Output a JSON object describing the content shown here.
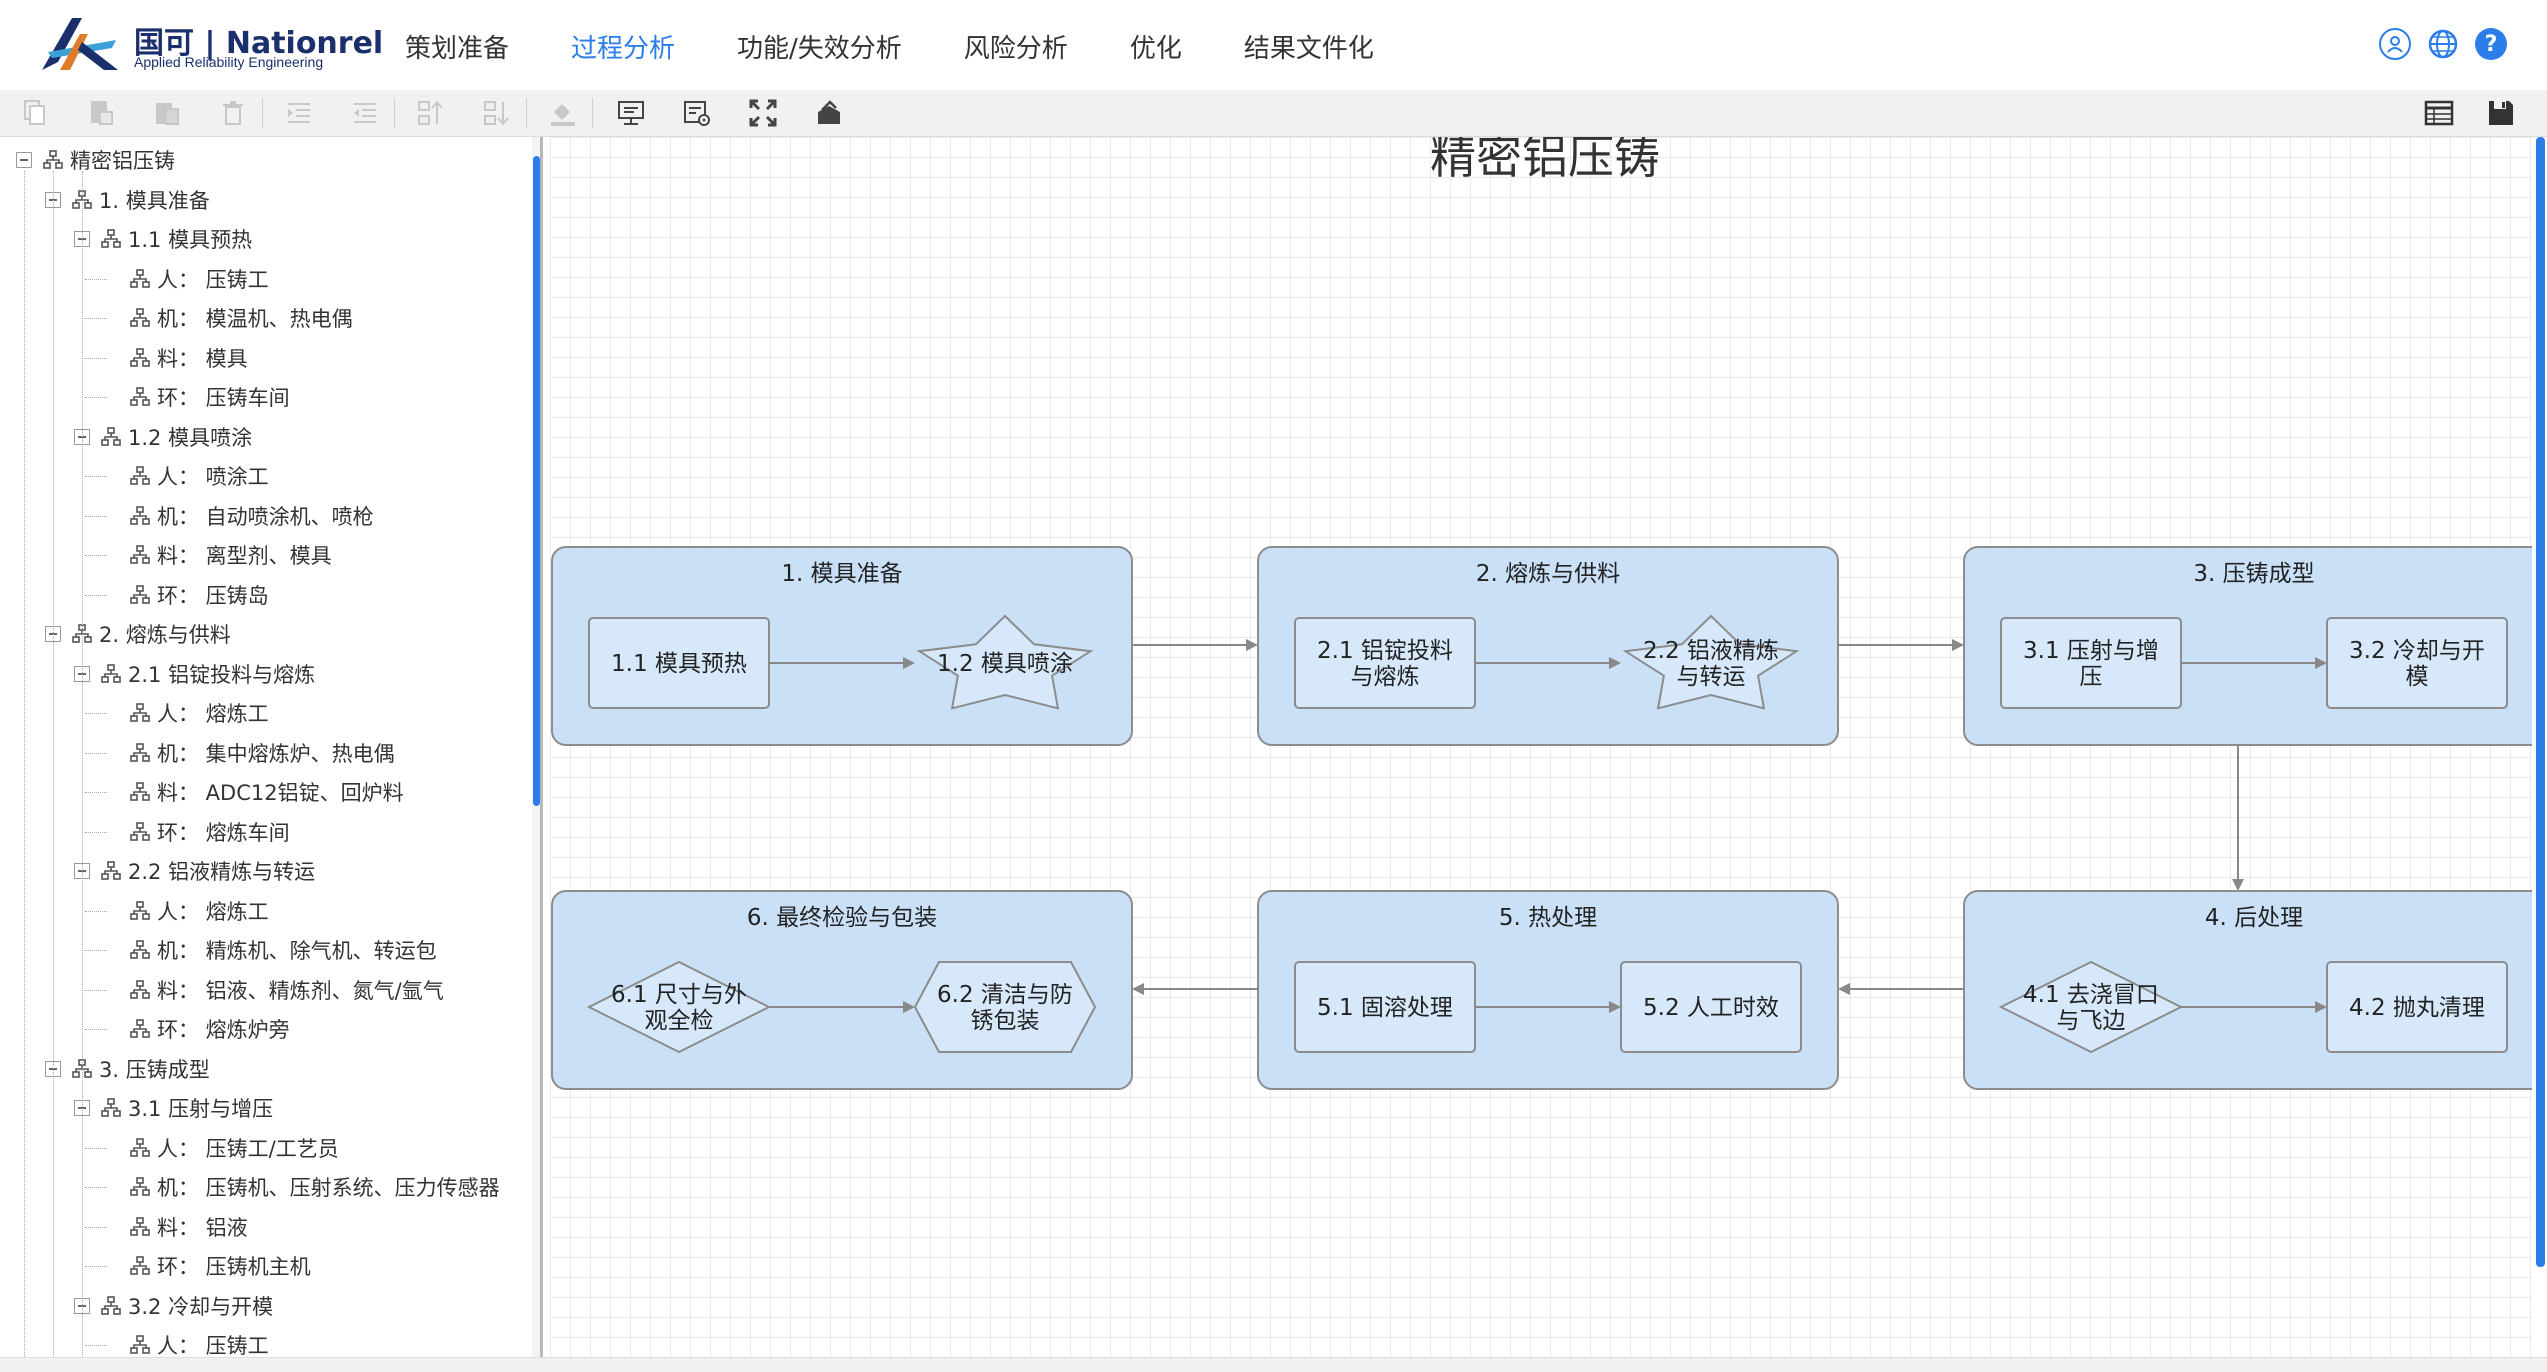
{
  "header": {
    "logo_cn": "国可 | Nationrel",
    "logo_en": "Applied Reliability Engineering",
    "nav": [
      {
        "label": "策划准备",
        "active": false
      },
      {
        "label": "过程分析",
        "active": true
      },
      {
        "label": "功能/失效分析",
        "active": false
      },
      {
        "label": "风险分析",
        "active": false
      },
      {
        "label": "优化",
        "active": false
      },
      {
        "label": "结果文件化",
        "active": false
      }
    ],
    "icons": [
      "user-icon",
      "globe-icon",
      "help-icon"
    ],
    "help_glyph": "?",
    "accent": "#2b7de9"
  },
  "toolbar": {
    "buttons": [
      "copy-icon",
      "paste-icon",
      "clipboard-icon",
      "delete-icon",
      "indent-icon",
      "outdent-icon",
      "move-up-icon",
      "move-down-icon",
      "fill-color-icon",
      "display-icon",
      "settings-icon",
      "fullscreen-icon",
      "layout-icon"
    ],
    "right_buttons": [
      "table-icon",
      "save-icon"
    ]
  },
  "tree": {
    "nodes": [
      {
        "level": 0,
        "label": "精密铝压铸",
        "toggle": true
      },
      {
        "level": 1,
        "label": "1. 模具准备",
        "toggle": true
      },
      {
        "level": 2,
        "label": "1.1 模具预热",
        "toggle": true
      },
      {
        "level": 3,
        "label": "人：  压铸工",
        "toggle": false
      },
      {
        "level": 3,
        "label": "机：  模温机、热电偶",
        "toggle": false
      },
      {
        "level": 3,
        "label": "料：  模具",
        "toggle": false
      },
      {
        "level": 3,
        "label": "环：  压铸车间",
        "toggle": false
      },
      {
        "level": 2,
        "label": "1.2 模具喷涂",
        "toggle": true
      },
      {
        "level": 3,
        "label": "人：  喷涂工",
        "toggle": false
      },
      {
        "level": 3,
        "label": "机：  自动喷涂机、喷枪",
        "toggle": false
      },
      {
        "level": 3,
        "label": "料：  离型剂、模具",
        "toggle": false
      },
      {
        "level": 3,
        "label": "环：  压铸岛",
        "toggle": false
      },
      {
        "level": 1,
        "label": "2. 熔炼与供料",
        "toggle": true
      },
      {
        "level": 2,
        "label": "2.1 铝锭投料与熔炼",
        "toggle": true
      },
      {
        "level": 3,
        "label": "人：  熔炼工",
        "toggle": false
      },
      {
        "level": 3,
        "label": "机：  集中熔炼炉、热电偶",
        "toggle": false
      },
      {
        "level": 3,
        "label": "料：  ADC12铝锭、回炉料",
        "toggle": false
      },
      {
        "level": 3,
        "label": "环：  熔炼车间",
        "toggle": false
      },
      {
        "level": 2,
        "label": "2.2 铝液精炼与转运",
        "toggle": true
      },
      {
        "level": 3,
        "label": "人：  熔炼工",
        "toggle": false
      },
      {
        "level": 3,
        "label": "机：  精炼机、除气机、转运包",
        "toggle": false
      },
      {
        "level": 3,
        "label": "料：  铝液、精炼剂、氮气/氩气",
        "toggle": false
      },
      {
        "level": 3,
        "label": "环：  熔炼炉旁",
        "toggle": false
      },
      {
        "level": 1,
        "label": "3. 压铸成型",
        "toggle": true
      },
      {
        "level": 2,
        "label": "3.1 压射与增压",
        "toggle": true
      },
      {
        "level": 3,
        "label": "人：  压铸工/工艺员",
        "toggle": false
      },
      {
        "level": 3,
        "label": "机：  压铸机、压射系统、压力传感器",
        "toggle": false
      },
      {
        "level": 3,
        "label": "料：  铝液",
        "toggle": false
      },
      {
        "level": 3,
        "label": "环：  压铸机主机",
        "toggle": false
      },
      {
        "level": 2,
        "label": "3.2 冷却与开模",
        "toggle": true
      },
      {
        "level": 3,
        "label": "人：  压铸工",
        "toggle": false
      }
    ]
  },
  "diagram": {
    "title": "精密铝压铸",
    "colors": {
      "group_fill": "#c9e0f7",
      "group_stroke": "#8c8c8c",
      "step_fill": "#d6e8fa",
      "arrow": "#888888",
      "text": "#222222"
    },
    "groups": [
      {
        "title": "1. 模具准备",
        "steps": [
          {
            "lines": [
              "1.1 模具预热"
            ],
            "shape": "rect"
          },
          {
            "lines": [
              "1.2 模具喷涂"
            ],
            "shape": "star"
          }
        ]
      },
      {
        "title": "2. 熔炼与供料",
        "steps": [
          {
            "lines": [
              "2.1 铝锭投料",
              "与熔炼"
            ],
            "shape": "rect"
          },
          {
            "lines": [
              "2.2 铝液精炼",
              "与转运"
            ],
            "shape": "star"
          }
        ]
      },
      {
        "title": "3. 压铸成型",
        "steps": [
          {
            "lines": [
              "3.1 压射与增",
              "压"
            ],
            "shape": "rect"
          },
          {
            "lines": [
              "3.2 冷却与开",
              "模"
            ],
            "shape": "rect"
          }
        ]
      },
      {
        "title": "4. 后处理",
        "steps": [
          {
            "lines": [
              "4.1 去浇冒口",
              "与飞边"
            ],
            "shape": "diamond"
          },
          {
            "lines": [
              "4.2 抛丸清理"
            ],
            "shape": "rect"
          }
        ]
      },
      {
        "title": "5. 热处理",
        "steps": [
          {
            "lines": [
              "5.1 固溶处理"
            ],
            "shape": "rect"
          },
          {
            "lines": [
              "5.2 人工时效"
            ],
            "shape": "rect"
          }
        ]
      },
      {
        "title": "6. 最终检验与包装",
        "steps": [
          {
            "lines": [
              "6.1 尺寸与外",
              "观全检"
            ],
            "shape": "diamond"
          },
          {
            "lines": [
              "6.2 清洁与防",
              "锈包装"
            ],
            "shape": "hexagon"
          }
        ]
      }
    ]
  }
}
